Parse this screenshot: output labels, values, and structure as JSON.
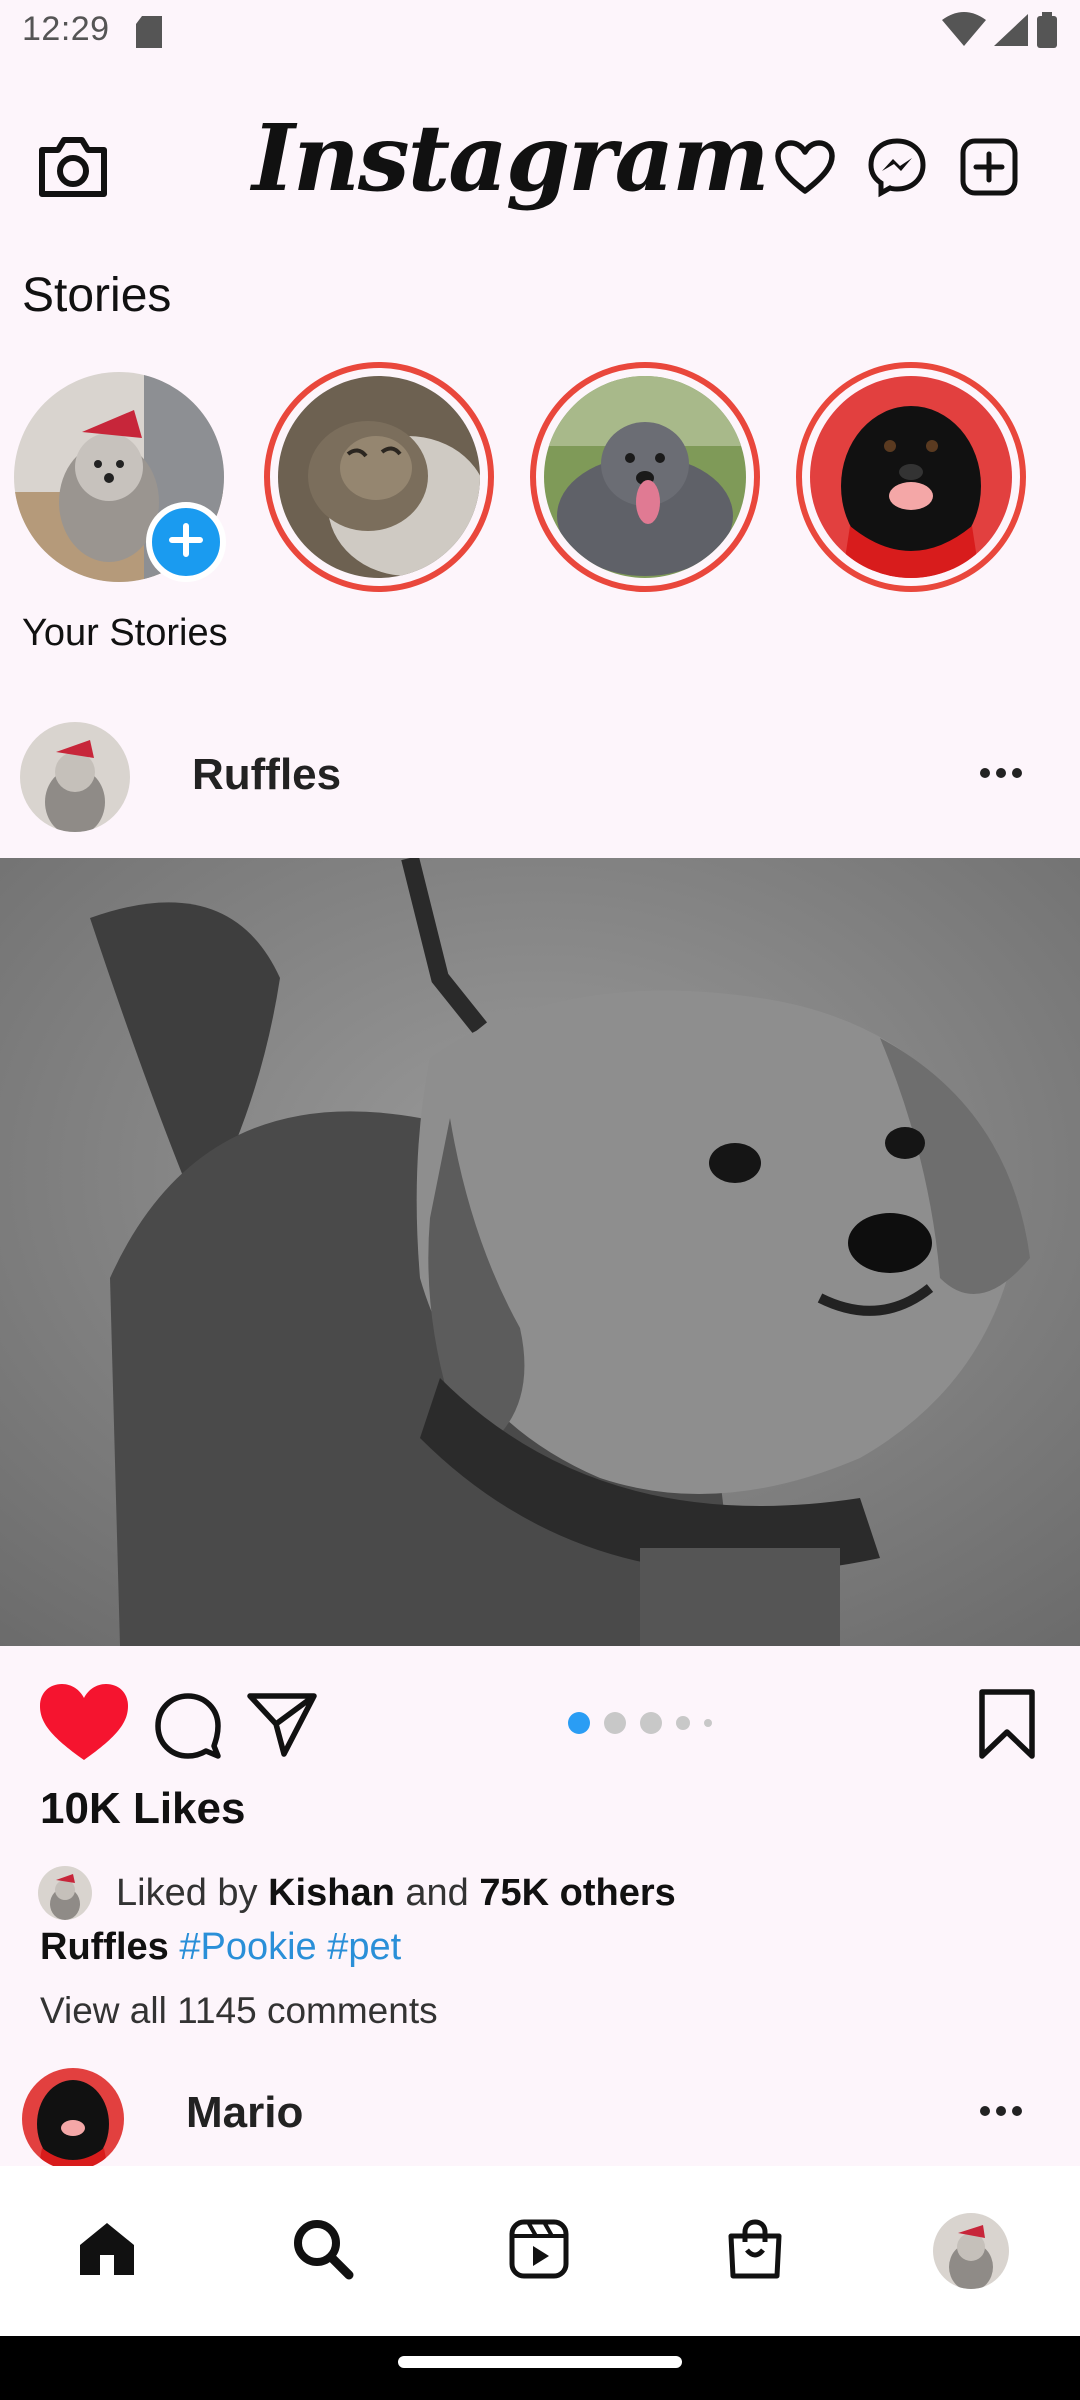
{
  "status_bar": {
    "time": "12:29",
    "icons": [
      "sd-card-icon",
      "wifi-icon",
      "signal-icon",
      "battery-icon"
    ]
  },
  "top_bar": {
    "title": "Instagram",
    "icons": [
      "camera-icon",
      "heart-outline-icon",
      "messenger-icon",
      "add-square-icon"
    ]
  },
  "stories": {
    "heading": "Stories",
    "own_label": "Your Stories",
    "items": [
      {
        "name": "your-story",
        "image": "white dog with red hat"
      },
      {
        "name": "story-cat",
        "image": "tabby cat"
      },
      {
        "name": "story-pitbull",
        "image": "gray pitbull"
      },
      {
        "name": "story-black-dog",
        "image": "black dog on red background"
      }
    ],
    "ring_color": "#e9473c",
    "add_button_color": "#1a9bf0"
  },
  "post": {
    "username": "Ruffles",
    "likes": "10K Likes",
    "liked_by_prefix": "Liked by",
    "liked_by_user": "Kishan",
    "liked_by_and": "and",
    "liked_by_others": "75K others",
    "caption_user": "Ruffles",
    "hashtags": [
      "#Pookie",
      "#pet"
    ],
    "view_comments": "View all 1145 comments",
    "carousel": {
      "total": 5,
      "active": 1
    },
    "liked": true,
    "like_color": "#f5142f",
    "hashtag_color": "#2a8fd8"
  },
  "next_post": {
    "username": "Mario"
  },
  "bottom_nav": {
    "items": [
      "home-icon",
      "search-icon",
      "reels-icon",
      "shop-icon",
      "profile-avatar"
    ],
    "active": "home-icon"
  }
}
